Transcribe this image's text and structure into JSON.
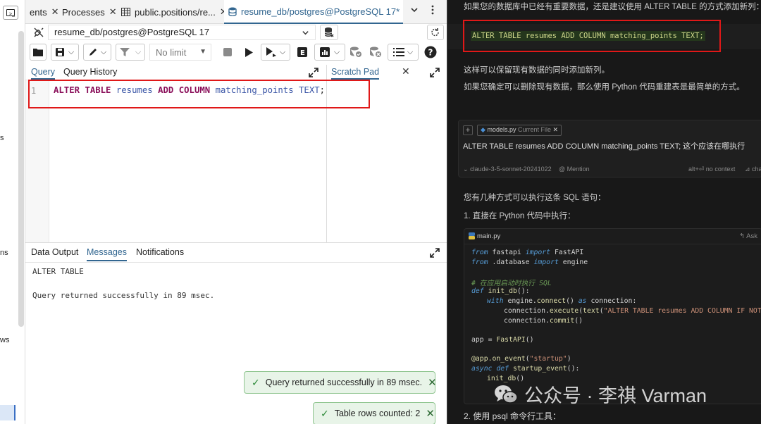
{
  "left_strip": {
    "fragments": [
      "s",
      "ns",
      "ws"
    ]
  },
  "pgadmin": {
    "tabs": [
      {
        "label": "ents",
        "active": false
      },
      {
        "label": "Processes",
        "active": false
      },
      {
        "label": "public.positions/re...",
        "active": false
      },
      {
        "label": "resume_db/postgres@PostgreSQL 17*",
        "active": true
      }
    ],
    "connection": {
      "label": "resume_db/postgres@PostgreSQL 17"
    },
    "toolbar": {
      "limit_label": "No limit"
    },
    "query_tabs": [
      "Query",
      "Query History"
    ],
    "scratch_pad": {
      "title": "Scratch Pad"
    },
    "editor": {
      "line_number": "1",
      "tokens": {
        "alter": "ALTER",
        "table": "TABLE",
        "table_name": "resumes",
        "add": "ADD",
        "column": "COLUMN",
        "column_name": "matching_points",
        "type": "TEXT",
        "semi": ";"
      }
    },
    "result_tabs": [
      "Data Output",
      "Messages",
      "Notifications"
    ],
    "messages": [
      "ALTER TABLE",
      "Query returned successfully in 89 msec."
    ],
    "toasts": [
      "Query returned successfully in 89 msec.",
      "Table rows counted: 2"
    ]
  },
  "chat": {
    "intro": "如果您的数据库中已经有重要数据，还是建议使用 ALTER TABLE 的方式添加新列：",
    "sql_snippet": "ALTER TABLE resumes ADD COLUMN matching_points TEXT;",
    "para1": "这样可以保留现有数据的同时添加新列。",
    "para2": "如果您确定可以删除现有数据，那么使用 Python 代码重建表是最简单的方式。",
    "card": {
      "file_chip": "models.py",
      "file_chip_sub": "Current File",
      "question": "ALTER TABLE resumes ADD COLUMN matching_points TEXT; 这个应该在哪执行",
      "model": "claude-3-5-sonnet-20241022",
      "mention": "@ Mention",
      "shortcut": "alt+⏎ no context",
      "chat": "⊿ chat"
    },
    "answer_intro": "您有几种方式可以执行这条 SQL 语句：",
    "step1": "1. 直接在 Python 代码中执行：",
    "code_file": "main.py",
    "code_ask": "↰ Ask",
    "code": {
      "l1_kw1": "from",
      "l1_mod": " fastapi ",
      "l1_kw2": "import",
      "l1_name": " FastAPI",
      "l2_kw1": "from",
      "l2_mod": " .database ",
      "l2_kw2": "import",
      "l2_name": " engine",
      "comment": "# 在应用启动时执行 SQL",
      "l4_def": "def",
      "l4_fn": " init_db",
      "l4_rest": "():",
      "l5_with": "with",
      "l5_mid": " engine.",
      "l5_fn": "connect",
      "l5_as": "as",
      "l5_end": " connection:",
      "l6_pre": "connection.",
      "l6_fn": "execute",
      "l6_fn2": "text",
      "l6_str": "\"ALTER TABLE resumes ADD COLUMN IF NOT EXISTS",
      "l7_pre": "connection.",
      "l7_fn": "commit",
      "l7_end": "()",
      "l8_pre": "app = ",
      "l8_fn": "FastAPI",
      "l8_end": "()",
      "l9_dec": "@app.on_event",
      "l9_str": "\"startup\"",
      "l10_async": "async def",
      "l10_fn": " startup_event",
      "l10_end": "():",
      "l11_fn": "init_db",
      "l11_end": "()"
    },
    "watermark": "公众号 · 李祺 Varman",
    "step2": "2. 使用 psql 命令行工具："
  }
}
